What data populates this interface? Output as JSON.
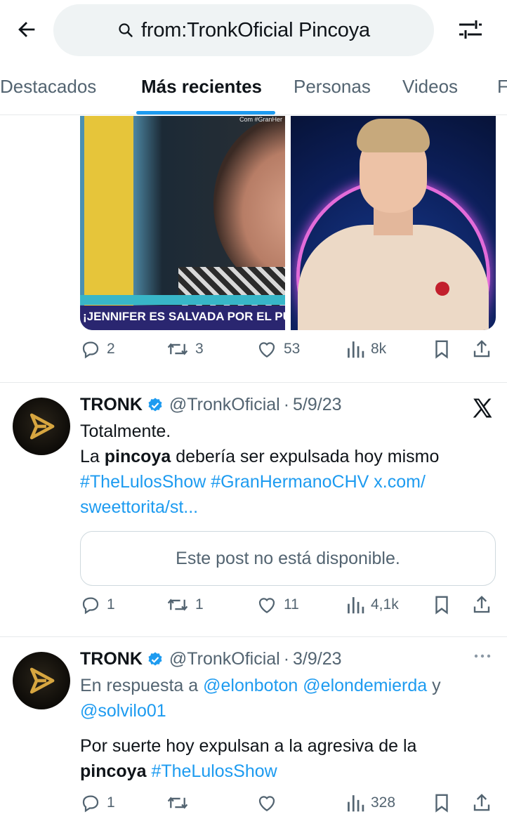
{
  "search": {
    "query": "from:TronkOficial Pincoya"
  },
  "tabs": [
    {
      "label": "Destacados"
    },
    {
      "label": "Más recientes"
    },
    {
      "label": "Personas"
    },
    {
      "label": "Videos"
    },
    {
      "label": "F"
    }
  ],
  "media_post": {
    "banner_text": "¡JENNIFER ES SALVADA POR EL PÚ",
    "watermark": "Com #GranHer",
    "stats": {
      "replies": "2",
      "reposts": "3",
      "likes": "53",
      "views": "8k"
    }
  },
  "posts": [
    {
      "name": "TRONK",
      "handle": "@TronkOficial",
      "separator": "·",
      "date": "5/9/23",
      "line1": "Totalmente.",
      "line2_pre": "La ",
      "line2_bold": "pincoya",
      "line2_post": " debería ser expulsada hoy mismo",
      "hashtag1": "#TheLulosShow",
      "hashtag2": "#GranHermanoCHV",
      "link_part1": "x.com/",
      "link_part2": "sweettorita/st...",
      "unavailable": "Este post no está disponible.",
      "stats": {
        "replies": "1",
        "reposts": "1",
        "likes": "11",
        "views": "4,1k"
      }
    },
    {
      "name": "TRONK",
      "handle": "@TronkOficial",
      "separator": "·",
      "date": "3/9/23",
      "reply_prefix": "En respuesta a",
      "mention1": "@elonboton",
      "mention2": "@elondemierda",
      "reply_and": "y",
      "mention3": "@solvilo01",
      "text_pre": "Por suerte hoy expulsan a la agresiva de la",
      "text_bold": "pincoya",
      "hashtag": "#TheLulosShow",
      "stats": {
        "replies": "1",
        "reposts": "",
        "likes": "",
        "views": "328"
      }
    }
  ],
  "colors": {
    "accent": "#1d9bf0",
    "muted": "#536471",
    "text": "#0f1419"
  }
}
